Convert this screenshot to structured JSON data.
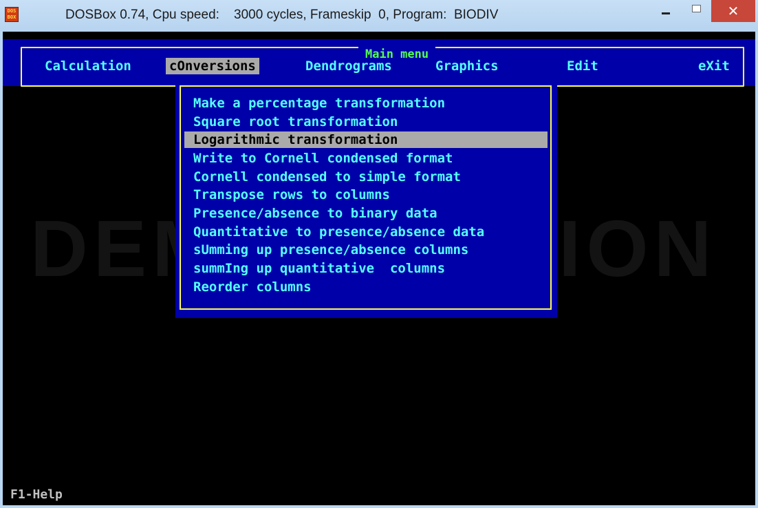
{
  "window": {
    "title": "DOSBox 0.74, Cpu speed:    3000 cycles, Frameskip  0, Program:  BIODIV",
    "icon_text": "DOS BOX",
    "controls": {
      "minimize": "–",
      "maximize": "□",
      "close": "✕"
    }
  },
  "watermark": "DEMO VERSION",
  "menubar": {
    "title": "Main menu",
    "items": [
      {
        "label": "Calculation",
        "selected": false
      },
      {
        "label": "cOnversions",
        "selected": true
      },
      {
        "label": "Dendrograms",
        "selected": false
      },
      {
        "label": "Graphics",
        "selected": false
      },
      {
        "label": "Edit",
        "selected": false
      },
      {
        "label": "eXit",
        "selected": false
      }
    ]
  },
  "dropdown": {
    "items": [
      "Make a percentage transformation",
      "Square root transformation",
      "Logarithmic transformation",
      "Write to Cornell condensed format",
      "Cornell condensed to simple format",
      "Transpose rows to columns",
      "Presence/absence to binary data",
      "Quantitative to presence/absence data",
      "sUmming up presence/absence columns",
      "summIng up quantitative  columns",
      "Reorder columns"
    ],
    "selected_index": 2
  },
  "status": {
    "help": "F1-Help"
  },
  "colors": {
    "dos_blue": "#0000a8",
    "dos_cyan": "#55ffff",
    "dos_yellow": "#fdfd55",
    "dos_green": "#54fe54",
    "highlight_gray": "#aaaaaa",
    "close_red": "#c7473a"
  }
}
